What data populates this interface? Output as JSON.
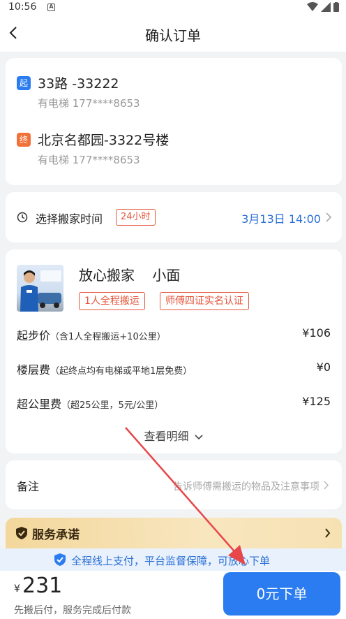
{
  "status_bar": {
    "time": "10:56",
    "notif": "A"
  },
  "header": {
    "title": "确认订单"
  },
  "addresses": {
    "start": {
      "tag": "起",
      "name": "33路 -33222",
      "detail": "有电梯  177****8653",
      "color": "#2a7cf0"
    },
    "end": {
      "tag": "终",
      "name": "北京名都园-3322号楼",
      "detail": "有电梯  177****8653",
      "color": "#f0723a"
    }
  },
  "schedule": {
    "label": "选择搬家时间",
    "badge": "24小时",
    "value": "3月13日 14:00"
  },
  "service": {
    "name": "放心搬家    小面",
    "tags": [
      "1人全程搬运",
      "师傅四证实名认证"
    ],
    "fees": [
      {
        "label": "起步价",
        "note": "（含1人全程搬运+10公里）",
        "amount": "¥106"
      },
      {
        "label": "楼层费",
        "note": "（起终点均有电梯或平地1层免费）",
        "amount": "¥0"
      },
      {
        "label": "超公里费",
        "note": "（超25公里，5元/公里）",
        "amount": "¥125"
      }
    ],
    "detail_link": "查看明细"
  },
  "remark": {
    "label": "备注",
    "placeholder": "告诉师傅需搬运的物品及注意事项"
  },
  "promise": {
    "label": "服务承诺"
  },
  "assurance": {
    "text": "全程线上支付，平台监督保障，可放心下单"
  },
  "footer": {
    "currency": "¥",
    "total": "231",
    "note": "先搬后付，服务完成后付款",
    "submit_label": "0元下单"
  },
  "colors": {
    "accent": "#2a7cf0",
    "warning": "#e5553b",
    "annotation_arrow": "#e8474a"
  }
}
